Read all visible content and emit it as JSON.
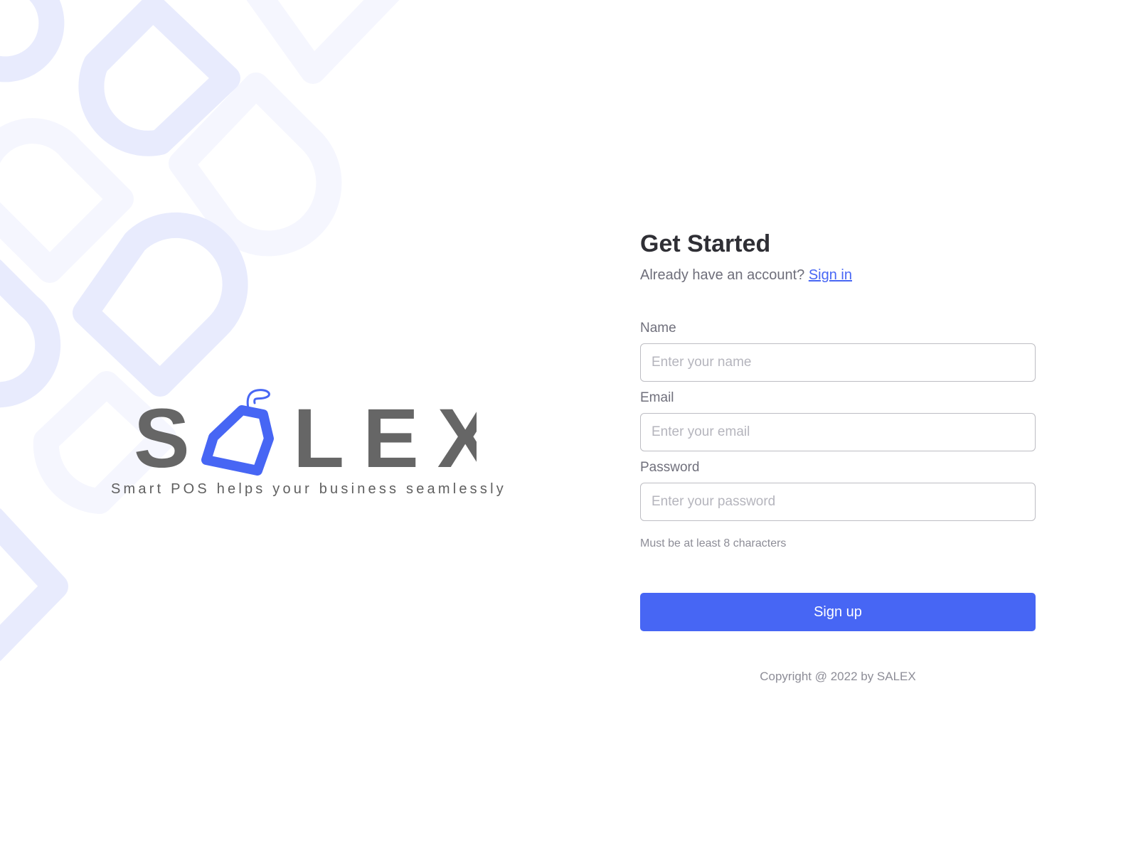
{
  "brand": {
    "logo_text": "SALEX",
    "tagline": "Smart POS helps your business seamlessly"
  },
  "colors": {
    "accent": "#4766f4",
    "logo_gray": "#666666",
    "pattern_light": "#e8ebfd",
    "pattern_lighter": "#f5f6fe"
  },
  "form": {
    "title": "Get Started",
    "account_prompt": "Already have an account?",
    "signin_link": "Sign in",
    "fields": {
      "name": {
        "label": "Name",
        "placeholder": "Enter your name"
      },
      "email": {
        "label": "Email",
        "placeholder": "Enter your email"
      },
      "password": {
        "label": "Password",
        "placeholder": "Enter your password"
      }
    },
    "password_hint": "Must be at least 8 characters",
    "submit_label": "Sign up"
  },
  "footer": {
    "copyright": "Copyright @ 2022 by SALEX"
  }
}
